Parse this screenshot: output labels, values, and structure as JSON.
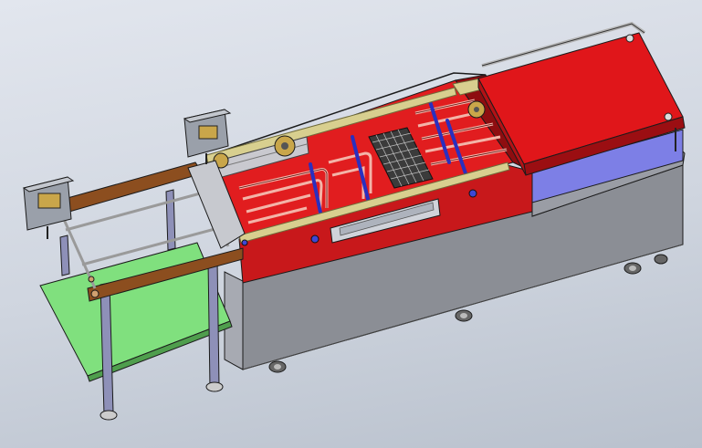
{
  "scene": {
    "kind": "cad-assembly-render",
    "colors": {
      "background_top": "#e2e6ee",
      "background_bottom": "#b9c1cd",
      "cabinet_front": "#8b8e95",
      "cabinet_side": "#a7aab2",
      "tank_body": "#c8181b",
      "tank_dark": "#8e0d10",
      "tank_floor": "#e11d1f",
      "heating_tube": "#f3b4a8",
      "rail": "#d8cf8f",
      "rail_outline": "#6f6a3a",
      "blue_bar": "#2a2fbf",
      "hood": "#e0161a",
      "hood_dark": "#9b0e12",
      "blue_panel": "#7d7fe6",
      "wood_frame": "#8c4e1f",
      "green_plate": "#80e07e",
      "leg": "#8e90b8",
      "motor_box": "#9aa0aa",
      "outline": "#1b1b1b"
    },
    "parts": [
      "cabinet",
      "heating-tank",
      "heating-tubes",
      "side-rails",
      "mesh-basket",
      "top-hood",
      "blue-side-panel",
      "wooden-frame",
      "green-infeed-plate",
      "support-legs",
      "motor-boxes",
      "casters"
    ]
  }
}
